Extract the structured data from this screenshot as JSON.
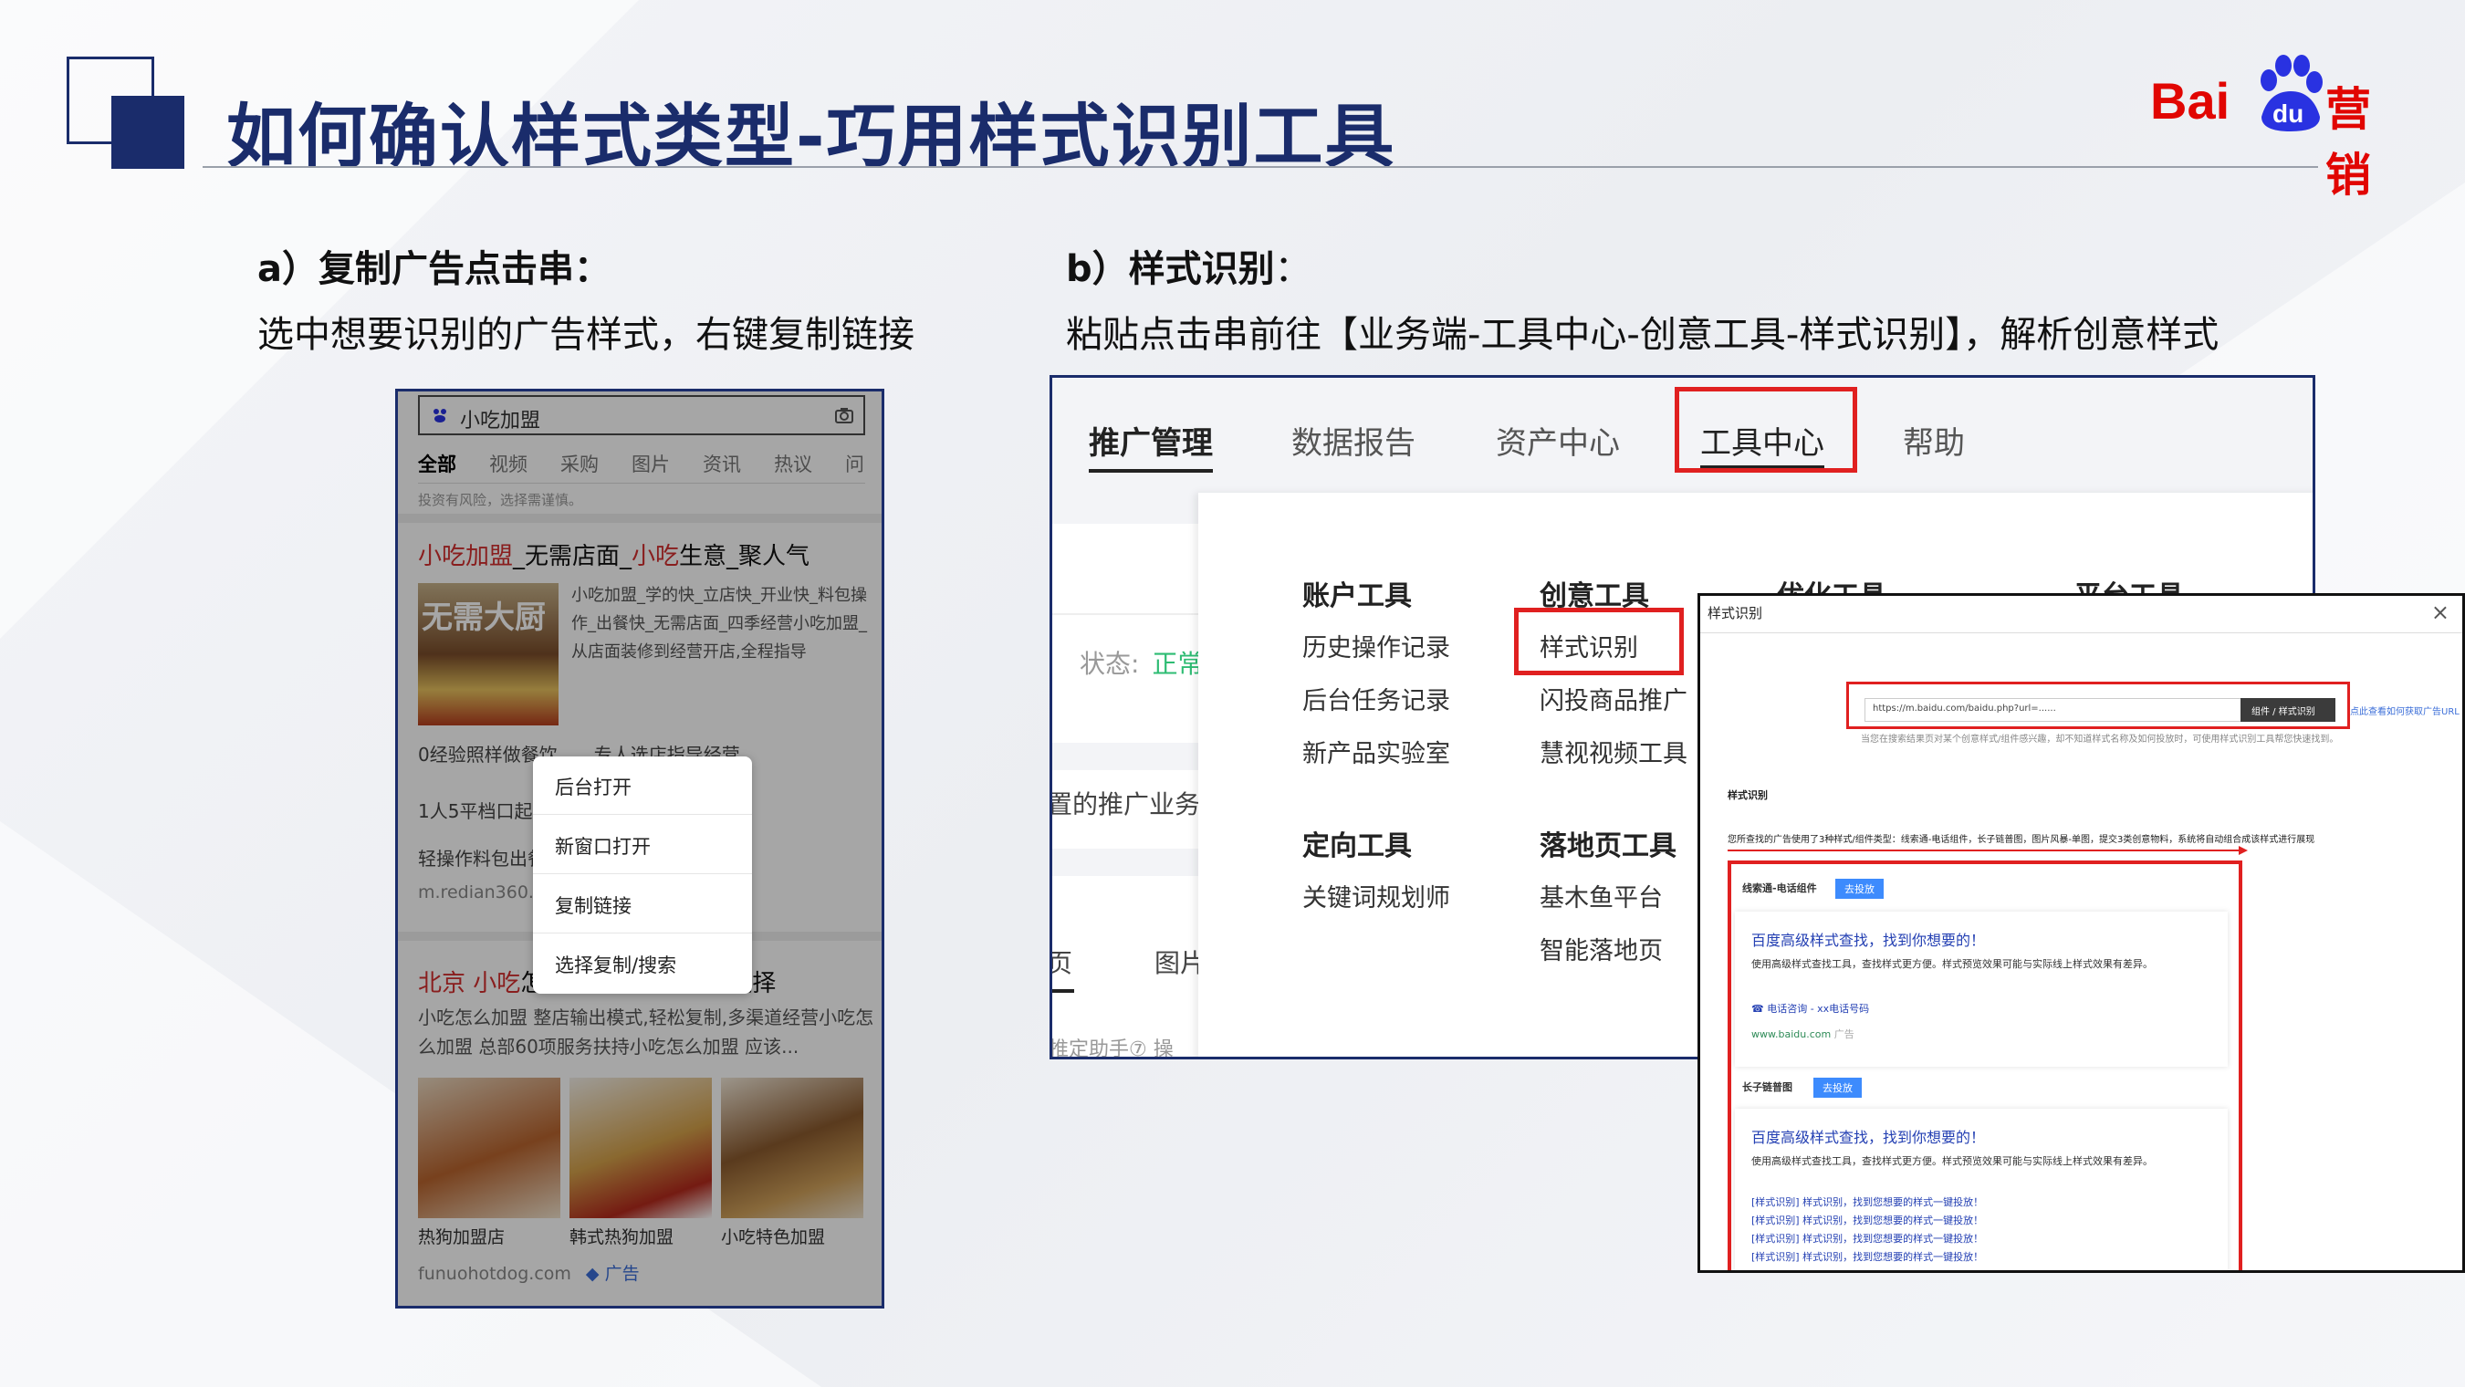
{
  "header": {
    "title": "如何确认样式类型-巧用样式识别工具",
    "logo_text_a": "Bai",
    "logo_text_du": "du",
    "logo_text_b": "营销"
  },
  "section_a": {
    "heading": "a）复制广告点击串：",
    "description": "选中想要识别的广告样式，右键复制链接"
  },
  "section_b": {
    "heading": "b）样式识别",
    "heading_suffix": "：",
    "description": "粘贴点击串前往【业务端-工具中心-创意工具-样式识别】，解析创意样式"
  },
  "phone": {
    "search_query": "小吃加盟",
    "tabs": [
      "全部",
      "视频",
      "采购",
      "图片",
      "资讯",
      "热议",
      "问"
    ],
    "risk_notice": "投资有风险，选择需谨慎。",
    "result1": {
      "title_red1": "小吃加盟",
      "title_mid": "_无需店面_",
      "title_red2": "小吃",
      "title_end": "生意_聚人气",
      "image_text": "无需大厨",
      "snippet": "小吃加盟_学的快_立店快_开业快_料包操作_出餐快_无需店面_四季经营小吃加盟_从店面装修到经营开店,全程指导",
      "line1": "0经验照样做餐饮",
      "line1b": "专人选店指导经营",
      "line2": "1人5平档口起步",
      "line3": "轻操作料包出餐",
      "url": "m.redian360.c"
    },
    "result2": {
      "title_red1": "北京 小吃",
      "title_end": "怎",
      "title_tail": "好选择",
      "snippet": "小吃怎么加盟 整店输出模式,轻松复制,多渠道经营小吃怎么加盟 总部60项服务扶持小吃怎么加盟 应该...",
      "captions": [
        "热狗加盟店",
        "韩式热狗加盟",
        "小吃特色加盟"
      ],
      "footer_url": "funuohotdog.com",
      "footer_ad": "广告"
    },
    "context_menu": [
      "后台打开",
      "新窗口打开",
      "复制链接",
      "选择复制/搜索"
    ]
  },
  "admin": {
    "nav": [
      "推广管理",
      "数据报告",
      "资产中心",
      "工具中心",
      "帮助"
    ],
    "bg_fragments": [
      "状态:",
      "正常",
      "置的推广业务",
      "页",
      "图片",
      "推定助手⑦ 操"
    ],
    "columns": [
      {
        "heading": "账户工具",
        "items": [
          "历史操作记录",
          "后台任务记录",
          "新产品实验室"
        ]
      },
      {
        "heading": "创意工具",
        "items": [
          "样式识别",
          "闪投商品推广",
          "慧视视频工具"
        ]
      },
      {
        "heading": "优化工具",
        "items": []
      },
      {
        "heading": "平台工具",
        "items": []
      }
    ],
    "columns2": [
      {
        "heading": "定向工具",
        "items": [
          "关键词规划师"
        ]
      },
      {
        "heading": "落地页工具",
        "items": [
          "基木鱼平台",
          "智能落地页"
        ]
      }
    ]
  },
  "tool": {
    "title": "样式识别",
    "url_value": "https://m.baidu.com/baidu.php?url=......",
    "button_label": "组件 / 样式识别",
    "help_link": "点此查看如何获取广告URL",
    "hint": "当您在搜索结果页对某个创意样式/组件感兴趣，却不知道样式名称及如何投放时，可使用样式识别工具帮您快速找到。",
    "section_label": "样式识别",
    "result_summary": "您所查找的广告使用了3种样式/组件类型：线索通-电话组件，长子链普图，图片风暴-单图，提交3类创意物料，系统将自动组合成该样式进行展现",
    "groups": [
      {
        "label": "线索通-电话组件",
        "tag": "去投放",
        "ad_title": "百度高级样式查找，找到你想要的！",
        "ad_desc": "使用高级样式查找工具，查找样式更方便。样式预览效果可能与实际线上样式效果有差异。",
        "ad_link": "电话咨询 - xx电话号码",
        "ad_url": "www.baidu.com",
        "ad_badge": "广告"
      },
      {
        "label": "长子链普图",
        "tag": "去投放",
        "ad_title": "百度高级样式查找，找到你想要的！",
        "ad_desc": "使用高级样式查找工具，查找样式更方便。样式预览效果可能与实际线上样式效果有差异。",
        "sublinks": [
          "[样式识别] 样式识别，找到您想要的样式一键投放！",
          "[样式识别] 样式识别，找到您想要的样式一键投放！",
          "[样式识别] 样式识别，找到您想要的样式一键投放！",
          "[样式识别] 样式识别，找到您想要的样式一键投放！"
        ]
      }
    ]
  }
}
